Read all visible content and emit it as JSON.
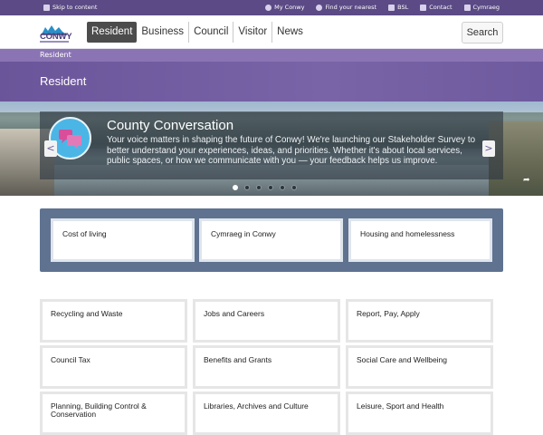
{
  "utility": {
    "skip": "Skip to content",
    "links": [
      "My Conwy",
      "Find your nearest",
      "BSL",
      "Contact",
      "Cymraeg"
    ]
  },
  "header": {
    "logo_text": "CONWY",
    "nav": [
      "Resident",
      "Business",
      "Council",
      "Visitor",
      "News"
    ],
    "active_tab": "Resident",
    "search_label": "Search"
  },
  "breadcrumb": "Resident",
  "page_title": "Resident",
  "hero": {
    "title": "County Conversation",
    "text": "Your voice matters in shaping the future of Conwy! We're launching our Stakeholder Survey to better understand your experiences, ideas, and priorities. Whether it's about local services, public spaces, or how we communicate with you — your feedback helps us improve.",
    "prev_label": "<",
    "next_label": ">",
    "slide_count": 6,
    "active_slide": 1
  },
  "featured": [
    "Cost of living",
    "Cymraeg in Conwy",
    "Housing and homelessness"
  ],
  "services": [
    [
      "Recycling and Waste",
      "Jobs and Careers",
      "Report, Pay, Apply"
    ],
    [
      "Council Tax",
      "Benefits and Grants",
      "Social Care and Wellbeing"
    ],
    [
      "Planning, Building Control & Conservation",
      "Libraries, Archives and Culture",
      "Leisure, Sport and Health"
    ]
  ],
  "colors": {
    "utility_bar": "#5b4a85",
    "title_band": "#7a64a8",
    "featured_bg": "#5f7290",
    "active_tab": "#4c4c4c"
  }
}
